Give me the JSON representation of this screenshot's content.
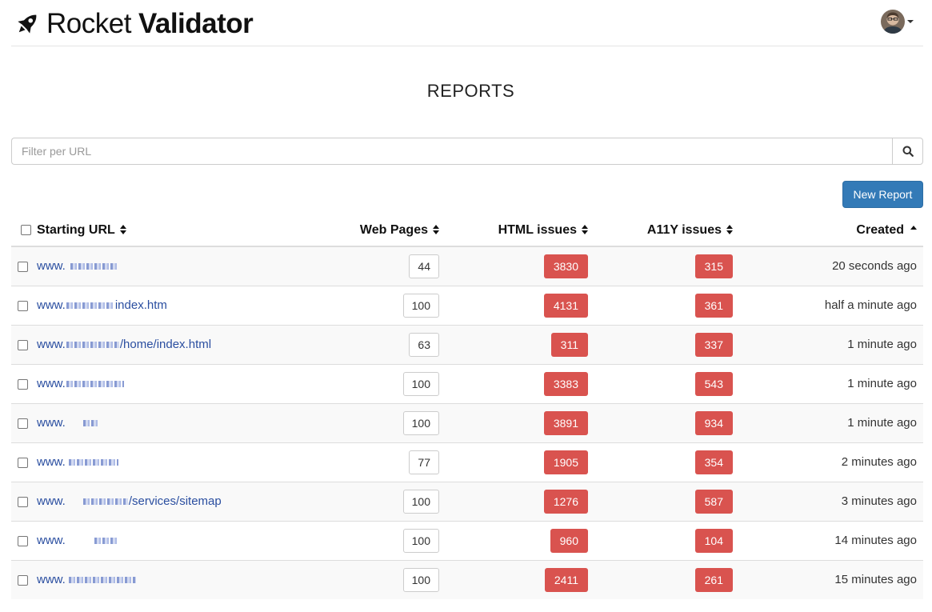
{
  "header": {
    "brand_light": "Rocket",
    "brand_bold": "Validator",
    "brand_icon": "rocket-icon",
    "user_icon": "avatar"
  },
  "title": "REPORTS",
  "search": {
    "placeholder": "Filter per URL",
    "value": "",
    "icon": "search-icon"
  },
  "new_report_label": "New Report",
  "colors": {
    "primary": "#337ab7",
    "danger": "#d9534f",
    "link": "#2a4ea0"
  },
  "table": {
    "columns": {
      "url": "Starting URL",
      "pages": "Web Pages",
      "html": "HTML issues",
      "a11y": "A11Y issues",
      "created": "Created"
    },
    "rows": [
      {
        "url_prefix": "www.",
        "url_suffix": "",
        "pages": "44",
        "html": "3830",
        "a11y": "315",
        "created": "20 seconds ago"
      },
      {
        "url_prefix": "www.",
        "url_suffix": "index.htm",
        "pages": "100",
        "html": "4131",
        "a11y": "361",
        "created": "half a minute ago"
      },
      {
        "url_prefix": "www.",
        "url_suffix": "/home/index.html",
        "pages": "63",
        "html": "311",
        "a11y": "337",
        "created": "1 minute ago"
      },
      {
        "url_prefix": "www.",
        "url_suffix": "",
        "pages": "100",
        "html": "3383",
        "a11y": "543",
        "created": "1 minute ago"
      },
      {
        "url_prefix": "www.",
        "url_suffix": "",
        "pages": "100",
        "html": "3891",
        "a11y": "934",
        "created": "1 minute ago"
      },
      {
        "url_prefix": "www.",
        "url_suffix": "",
        "pages": "77",
        "html": "1905",
        "a11y": "354",
        "created": "2 minutes ago"
      },
      {
        "url_prefix": "www.",
        "url_suffix": "/services/sitemap",
        "pages": "100",
        "html": "1276",
        "a11y": "587",
        "created": "3 minutes ago"
      },
      {
        "url_prefix": "www.",
        "url_suffix": "",
        "pages": "100",
        "html": "960",
        "a11y": "104",
        "created": "14 minutes ago"
      },
      {
        "url_prefix": "www.",
        "url_suffix": "",
        "pages": "100",
        "html": "2411",
        "a11y": "261",
        "created": "15 minutes ago"
      }
    ]
  }
}
